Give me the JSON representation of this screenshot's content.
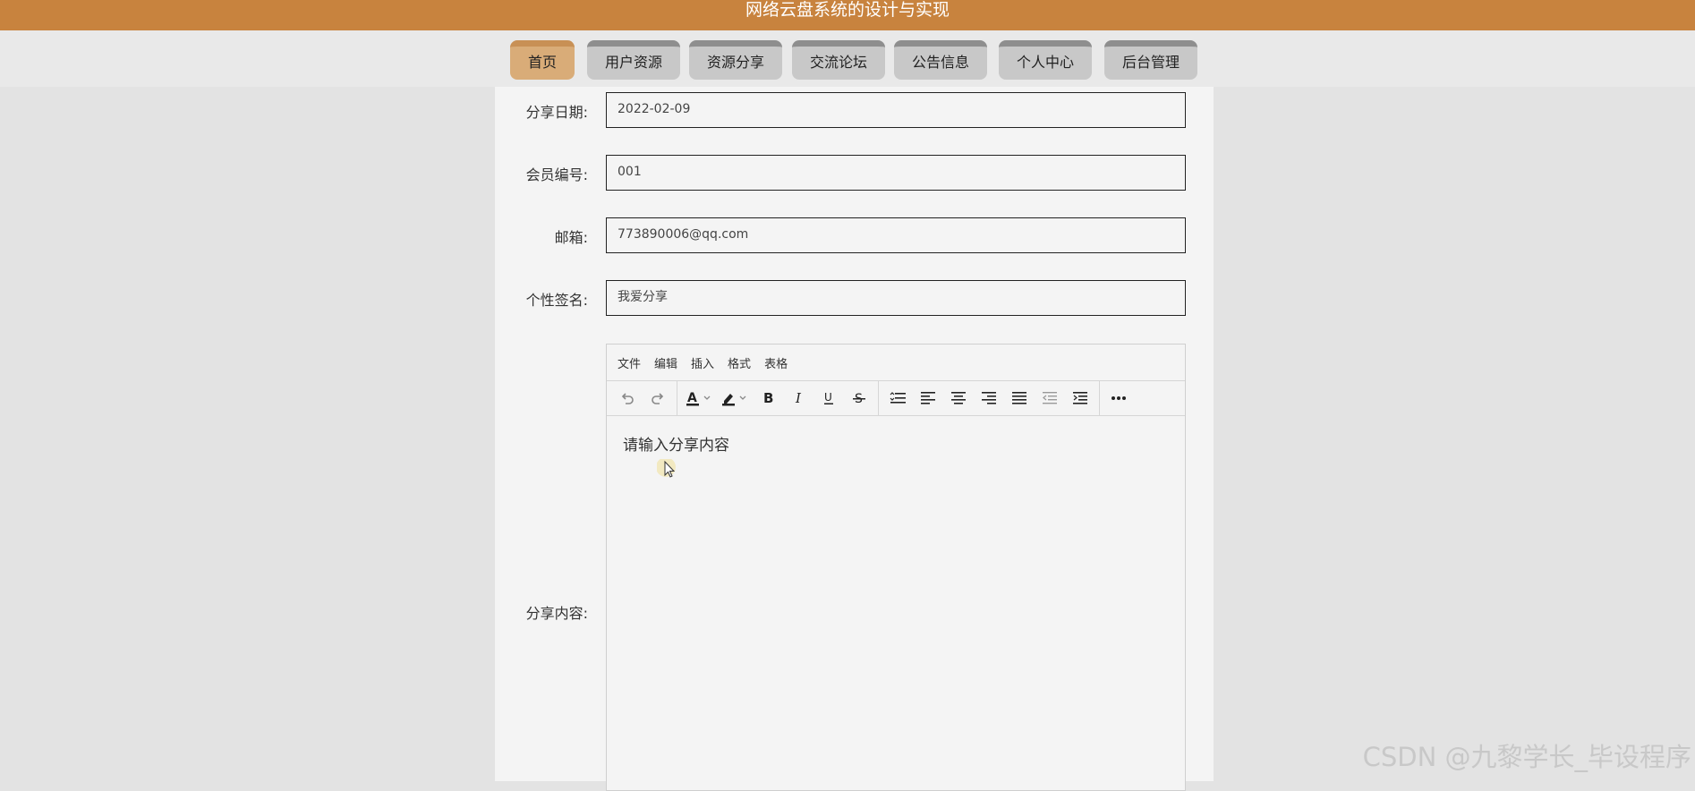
{
  "app": {
    "title": "网络云盘系统的设计与实现"
  },
  "nav": {
    "tabs": [
      {
        "label": "首页",
        "active": true
      },
      {
        "label": "用户资源"
      },
      {
        "label": "资源分享"
      },
      {
        "label": "交流论坛"
      },
      {
        "label": "公告信息"
      },
      {
        "label": "个人中心"
      },
      {
        "label": "后台管理"
      }
    ]
  },
  "form": {
    "share_date": {
      "label": "分享日期:",
      "value": "2022-02-09"
    },
    "member_no": {
      "label": "会员编号:",
      "value": "001"
    },
    "email": {
      "label": "邮箱:",
      "value": "773890006@qq.com"
    },
    "signature": {
      "label": "个性签名:",
      "value": "我爱分享"
    },
    "content": {
      "label": "分享内容:",
      "placeholder": "请输入分享内容"
    }
  },
  "editor": {
    "menu": [
      "文件",
      "编辑",
      "插入",
      "格式",
      "表格"
    ],
    "toolbar_icons": [
      "undo-icon",
      "redo-icon",
      "text-color-icon",
      "highlight-icon",
      "bold-icon",
      "italic-icon",
      "underline-icon",
      "strikethrough-icon",
      "line-height-icon",
      "align-left-icon",
      "align-center-icon",
      "align-right-icon",
      "align-justify-icon",
      "outdent-icon",
      "indent-icon",
      "more-icon"
    ]
  },
  "watermark": "CSDN @九黎学长_毕设程序",
  "colors": {
    "header": "#c8833e",
    "active_tab": "#d9ac78",
    "tab": "#c8c8c8"
  }
}
